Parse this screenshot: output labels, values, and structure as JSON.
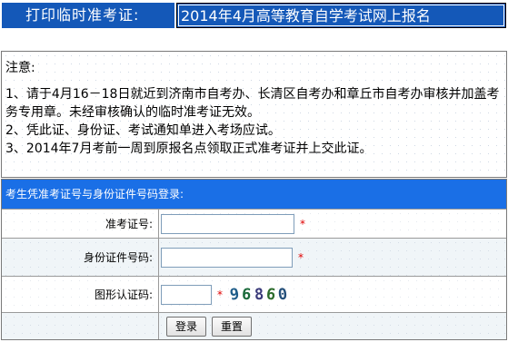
{
  "header": {
    "left_title": "打印临时准考证:",
    "right_title": "2014年4月高等教育自学考试网上报名"
  },
  "notice": {
    "heading": "注意:",
    "items": [
      "1、请于4月16－18日就近到济南市自考办、长清区自考办和章丘市自考办审核并加盖考务专用章。未经审核确认的临时准考证无效。",
      "2、凭此证、身份证、考试通知单进入考场应试。",
      "3、2014年7月考前一周到原报名点领取正式准考证并上交此证。"
    ]
  },
  "form": {
    "heading": "考生凭准考证号与身份证件号码登录:",
    "exam_id_label": "准考证号:",
    "exam_id_value": "",
    "id_card_label": "身份证件号码:",
    "id_card_value": "",
    "captcha_label": "图形认证码:",
    "captcha_value": "",
    "required_mark": "*",
    "captcha_digits": [
      "9",
      "6",
      "8",
      "6",
      "0"
    ],
    "login_label": "登录",
    "reset_label": "重置"
  }
}
